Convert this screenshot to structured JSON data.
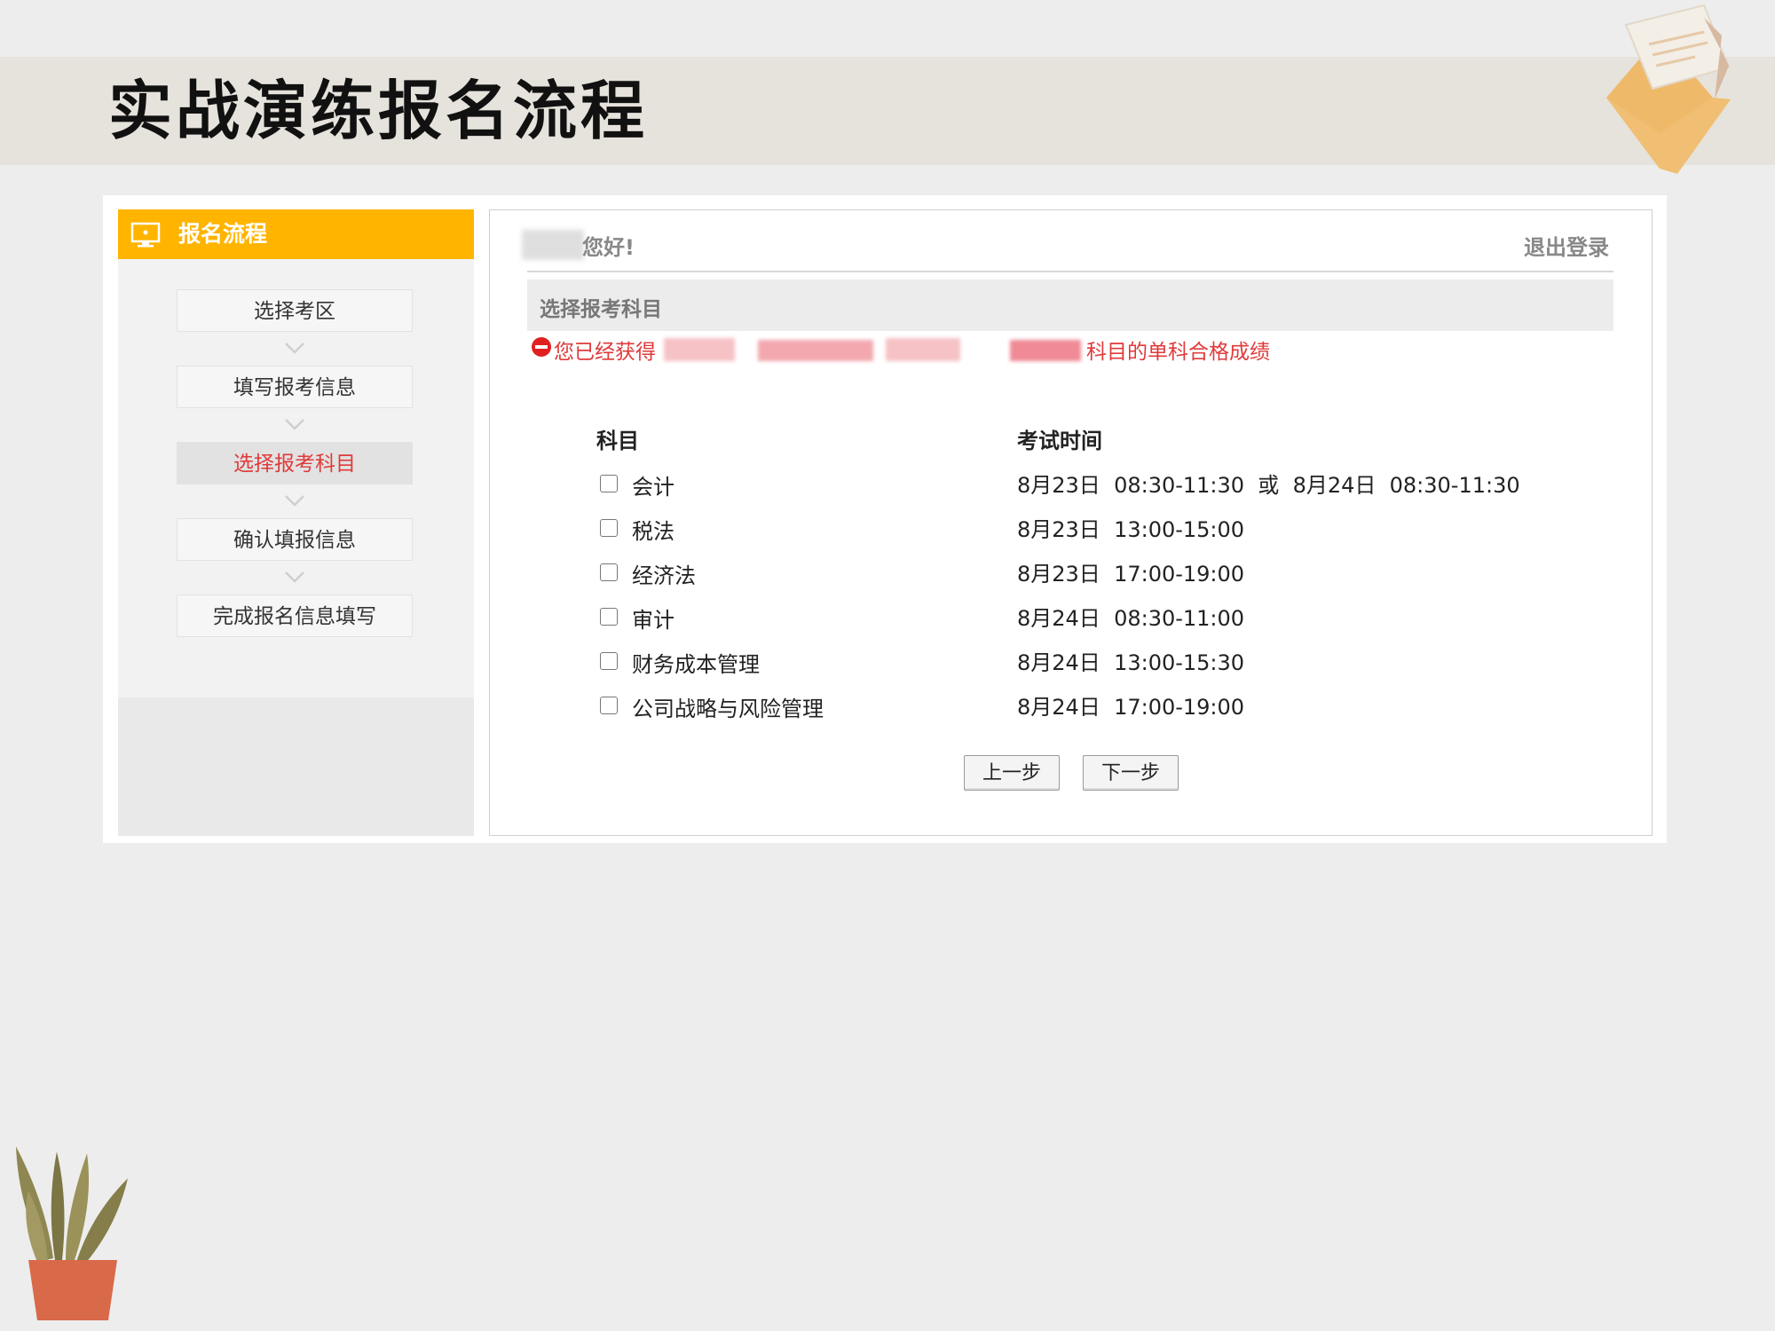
{
  "slide": {
    "title": "实战演练报名流程"
  },
  "sidebar": {
    "header": "报名流程",
    "steps": [
      {
        "label": "选择考区"
      },
      {
        "label": "填写报考信息"
      },
      {
        "label": "选择报考科目"
      },
      {
        "label": "确认填报信息"
      },
      {
        "label": "完成报名信息填写"
      }
    ],
    "active_step": 2
  },
  "main": {
    "greeting": "您好!",
    "logout": "退出登录",
    "section_title": "选择报考科目",
    "notice_prefix": "您已经获得",
    "notice_suffix": "科目的单科合格成绩",
    "col_subject": "科目",
    "col_time": "考试时间",
    "subjects": [
      {
        "name": "会计",
        "time": "8月23日  08:30-11:30  或  8月24日  08:30-11:30",
        "checked": false
      },
      {
        "name": "税法",
        "time": "8月23日  13:00-15:00",
        "checked": false
      },
      {
        "name": "经济法",
        "time": "8月23日  17:00-19:00",
        "checked": false
      },
      {
        "name": "审计",
        "time": "8月24日  08:30-11:00",
        "checked": false
      },
      {
        "name": "财务成本管理",
        "time": "8月24日  13:00-15:30",
        "checked": false
      },
      {
        "name": "公司战略与风险管理",
        "time": "8月24日  17:00-19:00",
        "checked": false
      }
    ],
    "prev_button": "上一步",
    "next_button": "下一步"
  },
  "colors": {
    "accent": "#ffb400",
    "alert": "#e03a3a",
    "title_band": "#e6e2dc"
  },
  "icons": {
    "sidebar_header": "monitor-icon",
    "notice": "error-icon",
    "decor_top": "envelope-icon",
    "decor_bottom": "plant-icon"
  }
}
